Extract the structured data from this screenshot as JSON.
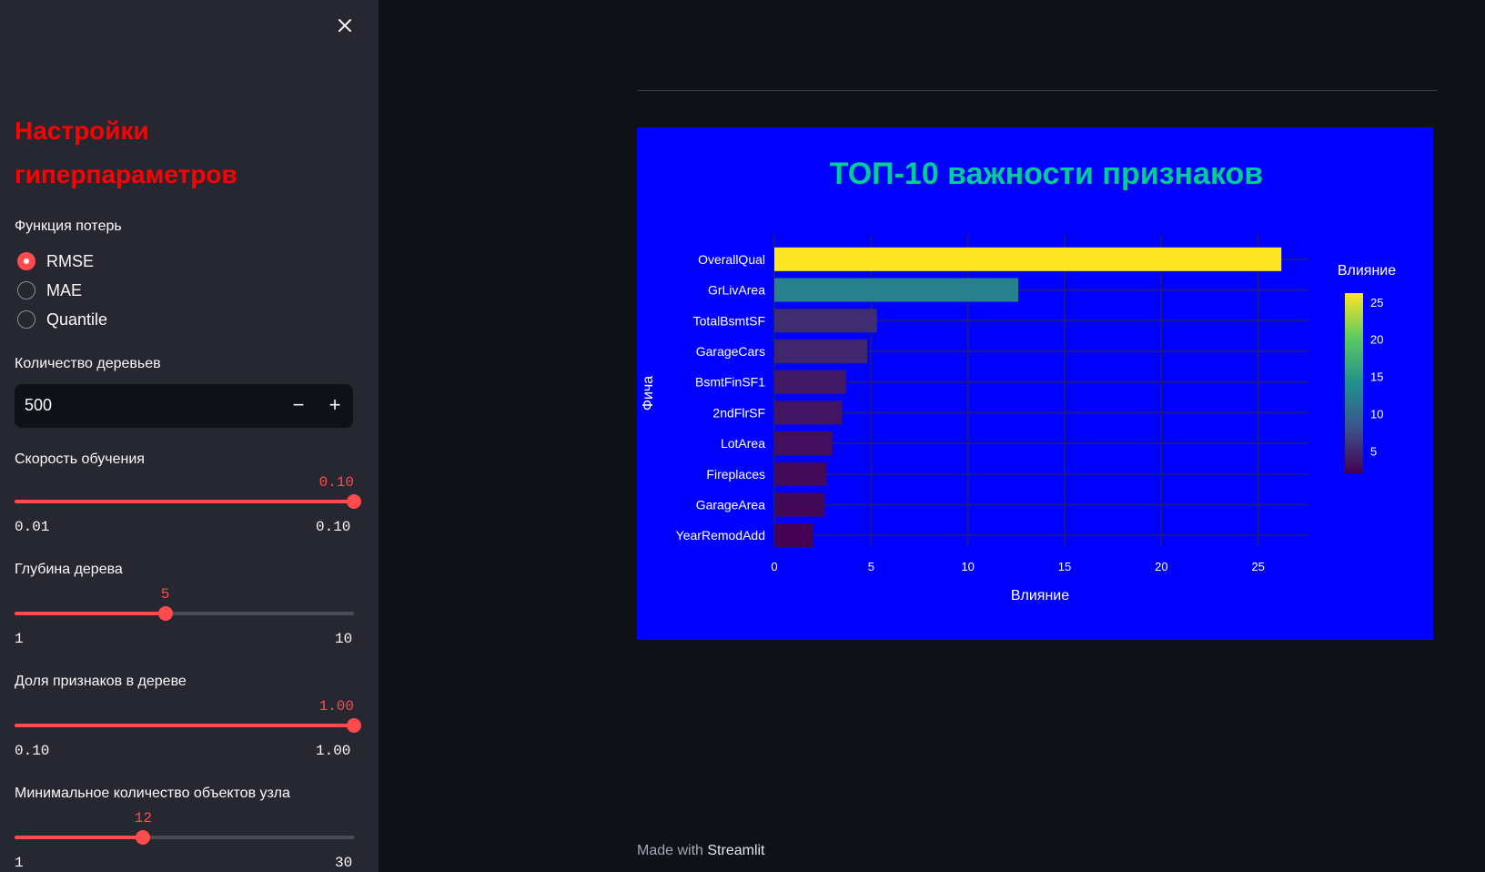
{
  "sidebar": {
    "title": "Настройки гиперпараметров",
    "loss": {
      "label": "Функция потерь",
      "options": [
        "RMSE",
        "MAE",
        "Quantile"
      ],
      "selected": "RMSE"
    },
    "n_trees": {
      "label": "Количество деревьев",
      "value": "500",
      "minus": "−",
      "plus": "+"
    },
    "learning_rate": {
      "label": "Скорость обучения",
      "value": "0.10",
      "min": "0.01",
      "max": "0.10",
      "fraction": 1.0
    },
    "depth": {
      "label": "Глубина дерева",
      "value": "5",
      "min": "1",
      "max": "10",
      "fraction": 0.444
    },
    "feature_frac": {
      "label": "Доля признаков в дереве",
      "value": "1.00",
      "min": "0.10",
      "max": "1.00",
      "fraction": 1.0
    },
    "min_samples": {
      "label": "Минимальное количество объектов узла",
      "value": "12",
      "min": "1",
      "max": "30",
      "fraction": 0.379
    }
  },
  "footer": {
    "prefix": "Made with",
    "brand": "Streamlit"
  },
  "chart_data": {
    "type": "bar",
    "orientation": "horizontal",
    "title": "ТОП-10 важности признаков",
    "xlabel": "Влияние",
    "ylabel": "Фича",
    "categories": [
      "OverallQual",
      "GrLivArea",
      "TotalBsmtSF",
      "GarageCars",
      "BsmtFinSF1",
      "2ndFlrSF",
      "LotArea",
      "Fireplaces",
      "GarageArea",
      "YearRemodAdd"
    ],
    "values": [
      26.2,
      12.6,
      5.3,
      4.8,
      3.7,
      3.5,
      3.0,
      2.7,
      2.6,
      2.0
    ],
    "xlim": [
      0,
      27.6
    ],
    "xticks": [
      "0",
      "5",
      "10",
      "15",
      "20",
      "25"
    ],
    "grid": true,
    "colorbar": {
      "title": "Влияние",
      "ticks": [
        "5",
        "10",
        "15",
        "20",
        "25"
      ],
      "colorscale": "viridis"
    },
    "colors": {
      "background": "#0000ff",
      "title": "#00cc96"
    }
  }
}
